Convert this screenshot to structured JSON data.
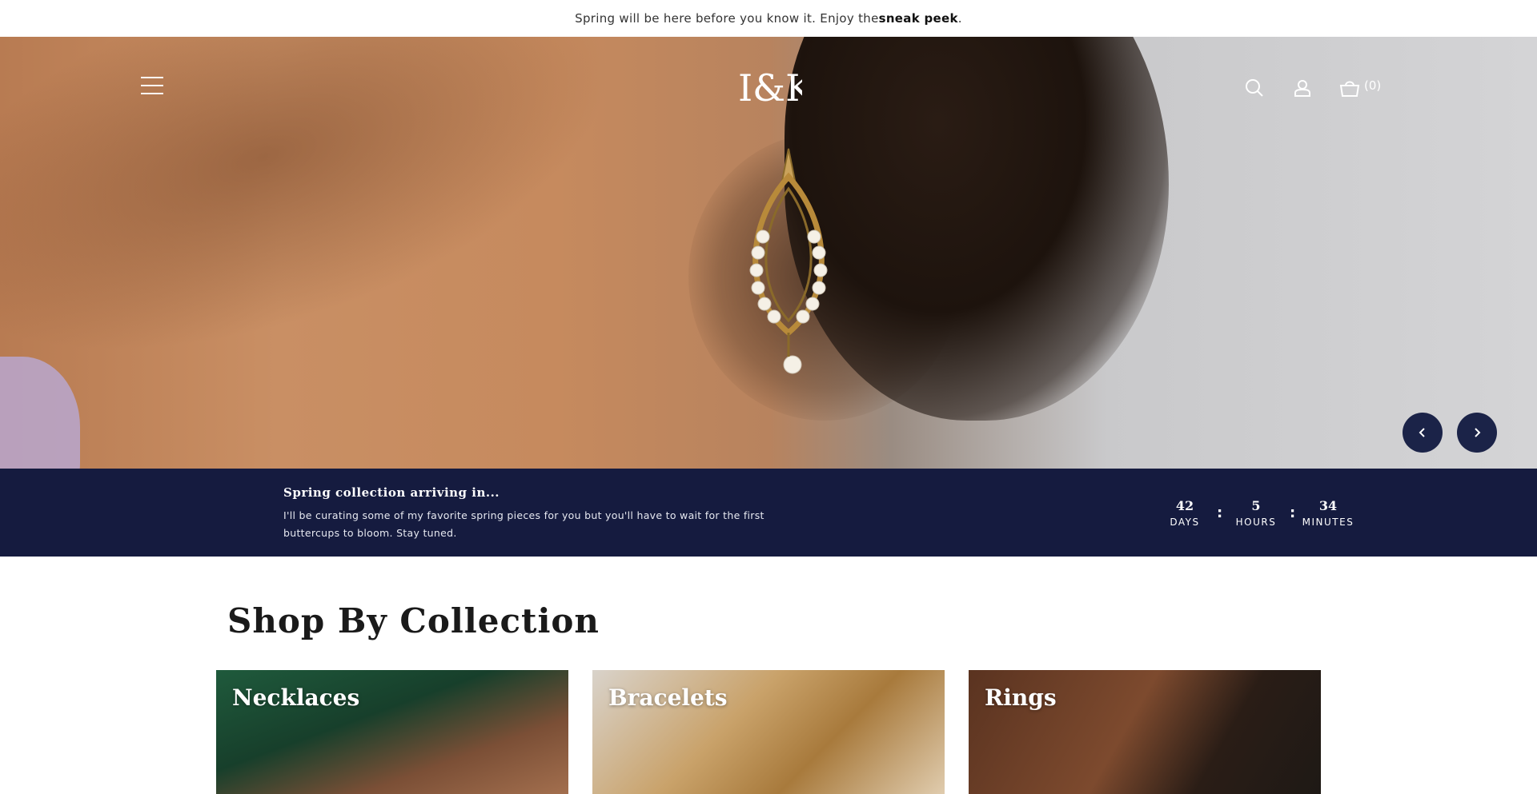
{
  "announcement": {
    "text": "Spring will be here before you know it. Enjoy the ",
    "link": "sneak peek",
    "suffix": "."
  },
  "header": {
    "logo_alt": "I&K",
    "cart_count": "(0)",
    "icons": [
      "menu-icon",
      "search-icon",
      "account-icon",
      "cart-icon"
    ]
  },
  "slider": {
    "prev_icon": "chevron-left-icon",
    "next_icon": "chevron-right-icon"
  },
  "countdown_banner": {
    "title": "Spring collection arriving in...",
    "text": "I'll be curating some of my favorite spring pieces for you but you'll have to wait for the first buttercups to bloom. Stay tuned.",
    "days": "42",
    "days_label": "DAYS",
    "hours": "5",
    "hours_label": "HOURS",
    "minutes": "34",
    "minutes_label": "MINUTES",
    "separator": ":"
  },
  "collections": {
    "title": "Shop By Collection",
    "items": [
      {
        "label": "Necklaces"
      },
      {
        "label": "Bracelets"
      },
      {
        "label": "Rings"
      }
    ]
  },
  "colors": {
    "banner_bg": "#151b3f",
    "arrow_bg": "#1b2348"
  }
}
